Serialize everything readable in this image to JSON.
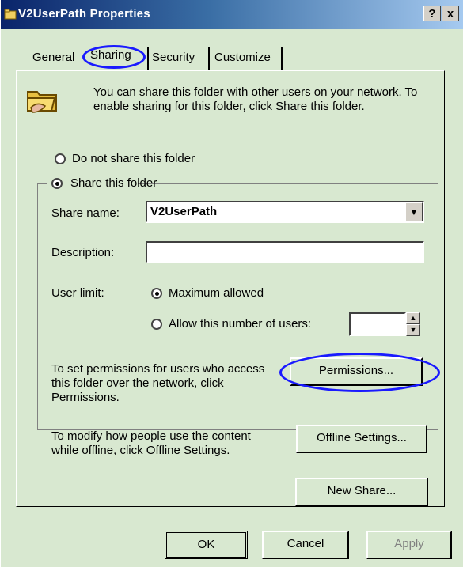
{
  "window": {
    "title": "V2UserPath Properties",
    "help_label": "?",
    "close_label": "x"
  },
  "tabs": [
    {
      "label": "General"
    },
    {
      "label": "Sharing"
    },
    {
      "label": "Security"
    },
    {
      "label": "Customize"
    }
  ],
  "intro_text": "You can share this folder with other users on your network.  To enable sharing for this folder, click Share this folder.",
  "sharing": {
    "do_not_share_label": "Do not share this folder",
    "share_label": "Share this folder",
    "selected": "share"
  },
  "share_name": {
    "label": "Share name:",
    "value": "V2UserPath"
  },
  "description": {
    "label": "Description:",
    "value": ""
  },
  "user_limit": {
    "label": "User limit:",
    "max_label": "Maximum allowed",
    "allow_label": "Allow this number of users:",
    "selected": "max",
    "count_value": ""
  },
  "permissions": {
    "text": "To set permissions for users who access this folder over the network, click Permissions.",
    "button_label": "Permissions..."
  },
  "offline": {
    "text": "To modify how people use the content while offline, click Offline Settings.",
    "button_label": "Offline Settings..."
  },
  "new_share_label": "New Share...",
  "footer": {
    "ok_label": "OK",
    "cancel_label": "Cancel",
    "apply_label": "Apply"
  },
  "colors": {
    "dialog_bg": "#d8e8d0",
    "title_start": "#0a246a",
    "highlight_ellipse": "#1a1aff"
  }
}
